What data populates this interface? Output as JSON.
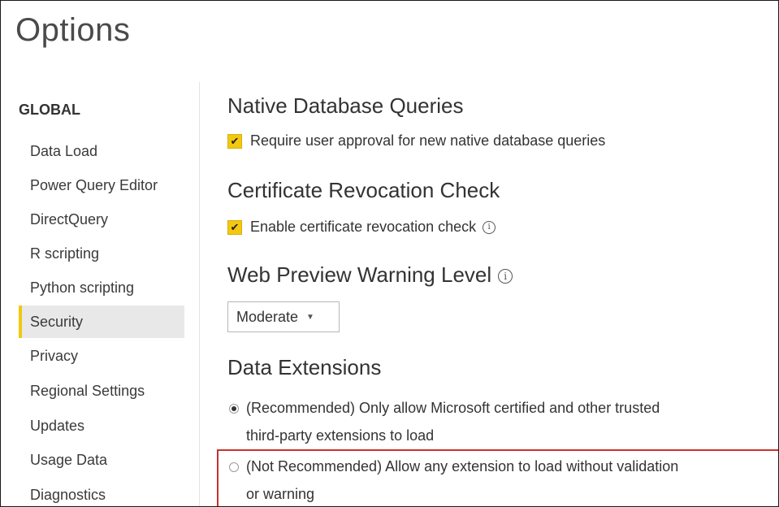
{
  "window": {
    "title": "Options"
  },
  "sidebar": {
    "section": "GLOBAL",
    "items": [
      {
        "label": "Data Load"
      },
      {
        "label": "Power Query Editor"
      },
      {
        "label": "DirectQuery"
      },
      {
        "label": "R scripting"
      },
      {
        "label": "Python scripting"
      },
      {
        "label": "Security",
        "selected": true
      },
      {
        "label": "Privacy"
      },
      {
        "label": "Regional Settings"
      },
      {
        "label": "Updates"
      },
      {
        "label": "Usage Data"
      },
      {
        "label": "Diagnostics"
      }
    ]
  },
  "content": {
    "native_db": {
      "heading": "Native Database Queries",
      "checkbox_label": "Require user approval for new native database queries",
      "checked": true
    },
    "cert_check": {
      "heading": "Certificate Revocation Check",
      "checkbox_label": "Enable certificate revocation check",
      "checked": true
    },
    "web_preview": {
      "heading": "Web Preview Warning Level",
      "dropdown_value": "Moderate"
    },
    "data_extensions": {
      "heading": "Data Extensions",
      "options": [
        {
          "line1": "(Recommended) Only allow Microsoft certified and other trusted",
          "line2": "third-party extensions to load",
          "selected": true
        },
        {
          "line1": "(Not Recommended) Allow any extension to load without validation",
          "line2": "or warning",
          "selected": false
        }
      ]
    }
  },
  "colors": {
    "accent": "#f2c811",
    "highlight_border": "#c8322b",
    "selected_bg": "#e8e8e8"
  }
}
